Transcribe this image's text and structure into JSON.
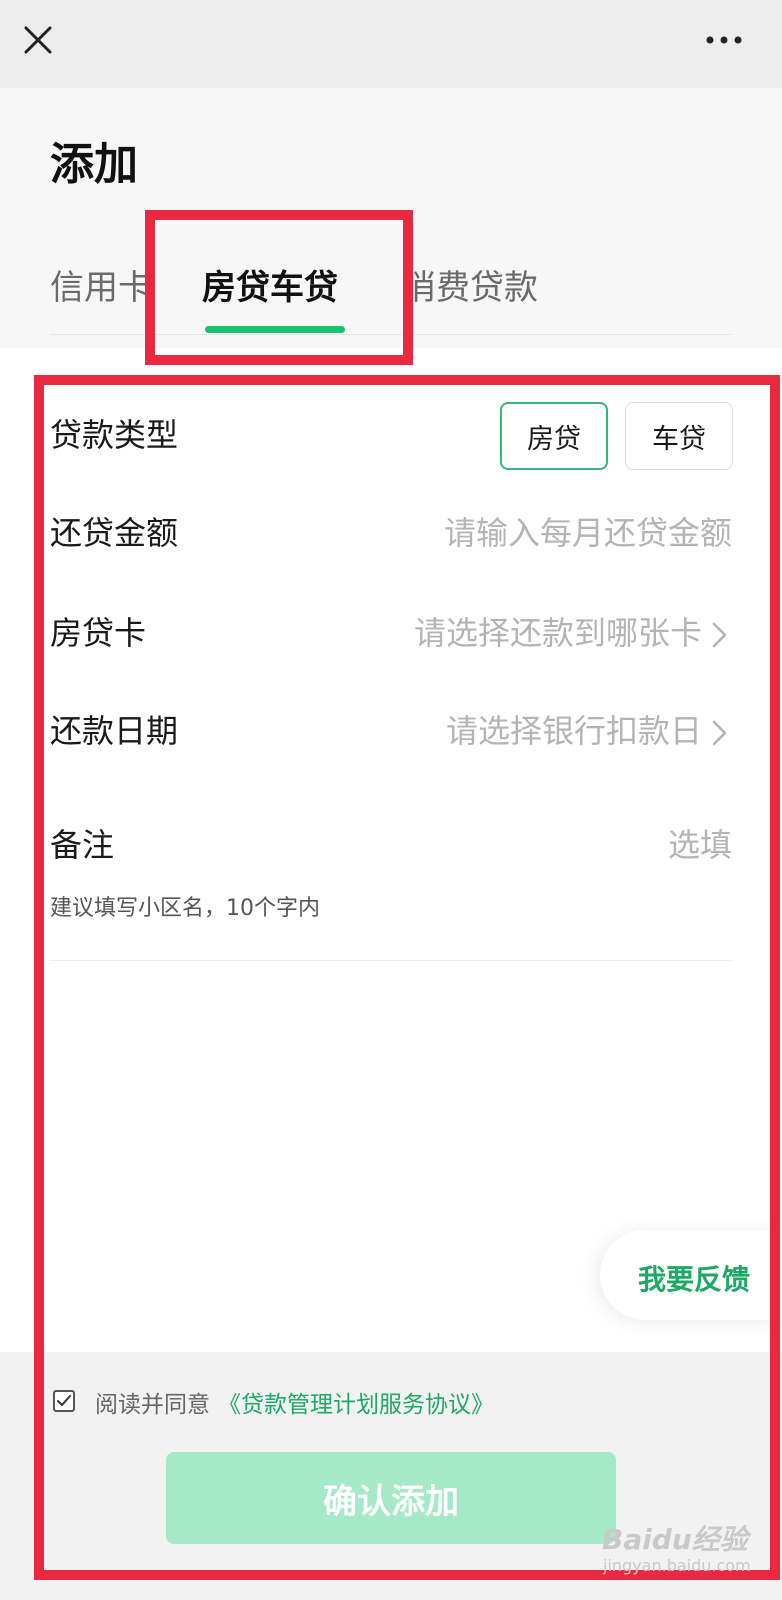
{
  "header": {
    "close_icon": "close-icon",
    "more_icon": "more-icon",
    "title": "添加"
  },
  "tabs": [
    {
      "label": "信用卡",
      "active": false
    },
    {
      "label": "房贷车贷",
      "active": true
    },
    {
      "label": "消费贷款",
      "active": false
    }
  ],
  "form": {
    "loan_type": {
      "label": "贷款类型",
      "options": [
        {
          "label": "房贷",
          "selected": true
        },
        {
          "label": "车贷",
          "selected": false
        }
      ]
    },
    "amount": {
      "label": "还贷金额",
      "placeholder": "请输入每月还贷金额"
    },
    "card": {
      "label": "房贷卡",
      "placeholder": "请选择还款到哪张卡"
    },
    "date": {
      "label": "还款日期",
      "placeholder": "请选择银行扣款日"
    },
    "remark": {
      "label": "备注",
      "placeholder": "选填",
      "hint": "建议填写小区名，10个字内"
    }
  },
  "feedback": {
    "label": "我要反馈"
  },
  "agreement": {
    "checked": true,
    "text": "阅读并同意",
    "link": "《贷款管理计划服务协议》"
  },
  "confirm": {
    "label": "确认添加"
  },
  "watermark": {
    "text": "Baidu经验",
    "sub": "jingyan.baidu.com"
  },
  "colors": {
    "accent": "#19c26c",
    "highlight": "#e8293f",
    "confirm_disabled": "#a6e9c8"
  }
}
